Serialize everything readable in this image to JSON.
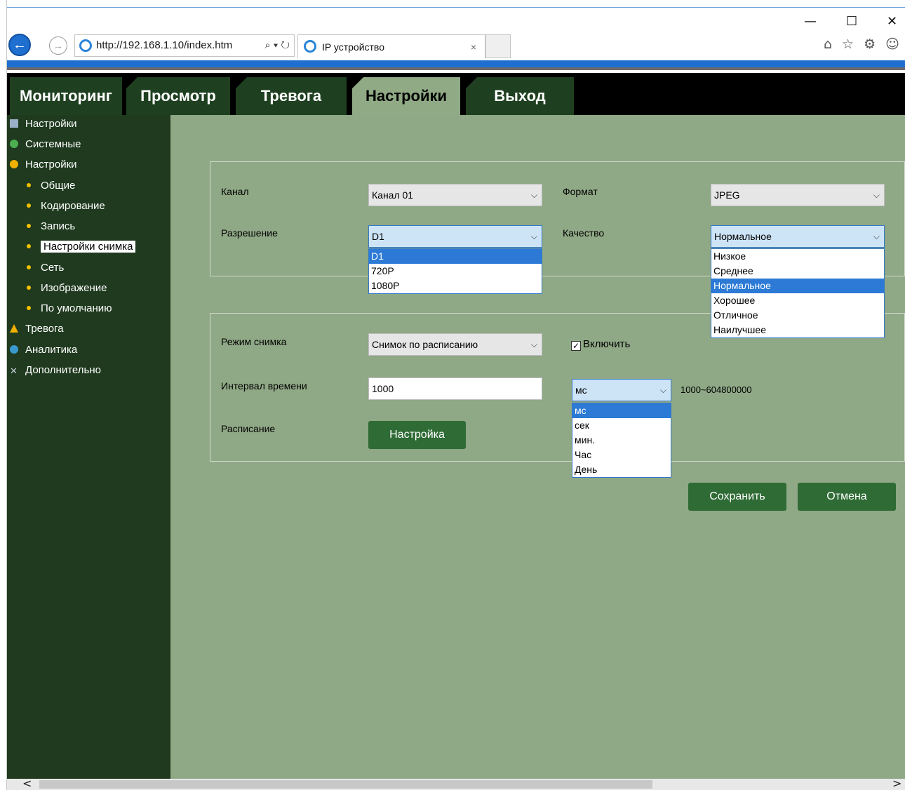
{
  "browser": {
    "url": "http://192.168.1.10/index.htm",
    "search_symbol": "⌕ ▾ ↻",
    "tab_title": "IP устройство",
    "tab_close": "×",
    "minimize": "—",
    "maximize": "☐",
    "close": "✕",
    "toolbar_icons": "⌂ ☆ ⚙ ☺"
  },
  "nav": {
    "tabs": [
      {
        "label": "Мониторинг"
      },
      {
        "label": "Просмотр"
      },
      {
        "label": "Тревога"
      },
      {
        "label": "Настройки"
      },
      {
        "label": "Выход"
      }
    ],
    "active": "Настройки"
  },
  "sidebar": {
    "items": [
      {
        "label": "Настройки",
        "icon": "monitor-icon"
      },
      {
        "label": "Системные",
        "icon": "info-icon"
      },
      {
        "label": "Настройки",
        "icon": "gear-icon"
      },
      {
        "label": "Общие"
      },
      {
        "label": "Кодирование"
      },
      {
        "label": "Запись"
      },
      {
        "label": "Настройки снимка"
      },
      {
        "label": "Сеть"
      },
      {
        "label": "Изображение"
      },
      {
        "label": "По умолчанию"
      },
      {
        "label": "Тревога",
        "icon": "bell-icon"
      },
      {
        "label": "Аналитика",
        "icon": "analytics-icon"
      },
      {
        "label": "Дополнительно",
        "icon": "tools-icon"
      }
    ],
    "selected": "Настройки снимка"
  },
  "form": {
    "channel": {
      "label": "Канал",
      "value": "Канал 01"
    },
    "format": {
      "label": "Формат",
      "value": "JPEG"
    },
    "resolution": {
      "label": "Разрешение",
      "value": "D1",
      "options": [
        "D1",
        "720P",
        "1080P"
      ],
      "highlighted": "D1"
    },
    "quality": {
      "label": "Качество",
      "value": "Нормальное",
      "options": [
        "Низкое",
        "Среднее",
        "Нормальное",
        "Хорошее",
        "Отличное",
        "Наилучшее"
      ],
      "highlighted": "Нормальное"
    },
    "snap_mode": {
      "label": "Режим снимка",
      "value": "Снимок по расписанию"
    },
    "enable": {
      "label": "Включить",
      "checked": true,
      "mark": "✓"
    },
    "interval": {
      "label": "Интервал времени",
      "value": "1000",
      "range": "1000~604800000"
    },
    "unit": {
      "value": "мс",
      "options": [
        "мс",
        "сек",
        "мин.",
        "Час",
        "День"
      ],
      "highlighted": "мс"
    },
    "schedule": {
      "label": "Расписание",
      "button": "Настройка"
    }
  },
  "actions": {
    "save": "Сохранить",
    "cancel": "Отмена"
  },
  "scroll": {
    "left": "<",
    "right": ">"
  },
  "colors": {
    "sidebar": "#1f3a1f",
    "content": "#8fa885",
    "button": "#2f6b35",
    "highlight": "#2c7ad6"
  }
}
